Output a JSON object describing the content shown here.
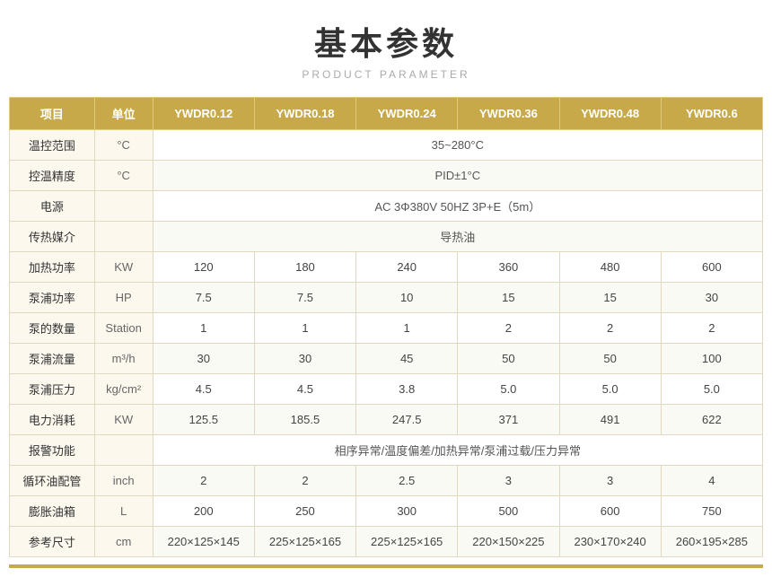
{
  "header": {
    "title": "基本参数",
    "subtitle": "PRODUCT PARAMETER"
  },
  "table": {
    "columns": [
      "项目",
      "单位",
      "YWDR0.12",
      "YWDR0.18",
      "YWDR0.24",
      "YWDR0.36",
      "YWDR0.48",
      "YWDR0.6"
    ],
    "rows": [
      {
        "label": "温控范围",
        "unit": "°C",
        "span": true,
        "spanValue": "35~280°C"
      },
      {
        "label": "控温精度",
        "unit": "°C",
        "span": true,
        "spanValue": "PID±1°C"
      },
      {
        "label": "电源",
        "unit": "",
        "span": true,
        "spanValue": "AC 3Φ380V 50HZ 3P+E（5m）"
      },
      {
        "label": "传热媒介",
        "unit": "",
        "span": true,
        "spanValue": "导热油"
      },
      {
        "label": "加热功率",
        "unit": "KW",
        "span": false,
        "values": [
          "120",
          "180",
          "240",
          "360",
          "480",
          "600"
        ]
      },
      {
        "label": "泵浦功率",
        "unit": "HP",
        "span": false,
        "values": [
          "7.5",
          "7.5",
          "10",
          "15",
          "15",
          "30"
        ]
      },
      {
        "label": "泵的数量",
        "unit": "Station",
        "span": false,
        "values": [
          "1",
          "1",
          "1",
          "2",
          "2",
          "2"
        ]
      },
      {
        "label": "泵浦流量",
        "unit": "m³/h",
        "span": false,
        "values": [
          "30",
          "30",
          "45",
          "50",
          "50",
          "100"
        ]
      },
      {
        "label": "泵浦压力",
        "unit": "kg/cm²",
        "span": false,
        "values": [
          "4.5",
          "4.5",
          "3.8",
          "5.0",
          "5.0",
          "5.0"
        ]
      },
      {
        "label": "电力消耗",
        "unit": "KW",
        "span": false,
        "values": [
          "125.5",
          "185.5",
          "247.5",
          "371",
          "491",
          "622"
        ]
      },
      {
        "label": "报警功能",
        "unit": "",
        "span": true,
        "spanValue": "相序异常/温度偏差/加热异常/泵浦过载/压力异常"
      },
      {
        "label": "循环油配管",
        "unit": "inch",
        "span": false,
        "values": [
          "2",
          "2",
          "2.5",
          "3",
          "3",
          "4"
        ]
      },
      {
        "label": "膨胀油箱",
        "unit": "L",
        "span": false,
        "values": [
          "200",
          "250",
          "300",
          "500",
          "600",
          "750"
        ]
      },
      {
        "label": "参考尺寸",
        "unit": "cm",
        "span": false,
        "values": [
          "220×125×145",
          "225×125×165",
          "225×125×165",
          "220×150×225",
          "230×170×240",
          "260×195×285"
        ]
      }
    ]
  }
}
